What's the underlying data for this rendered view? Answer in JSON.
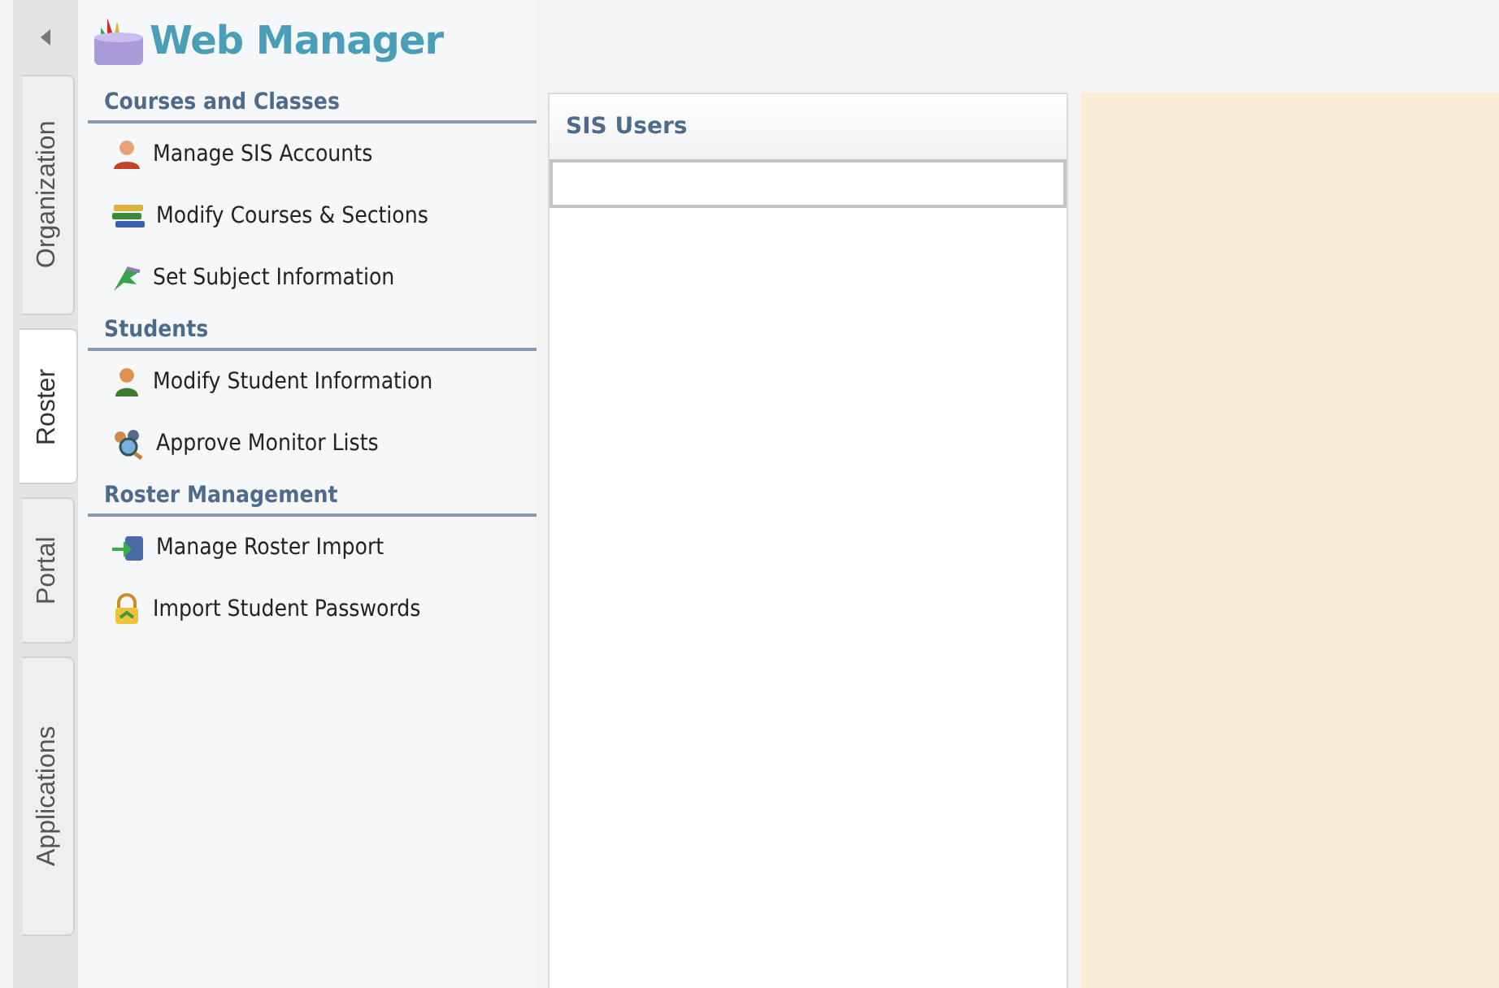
{
  "app": {
    "title": "Web Manager"
  },
  "side_tabs": [
    {
      "label": "Organization",
      "selected": false
    },
    {
      "label": "Roster",
      "selected": true
    },
    {
      "label": "Portal",
      "selected": false
    },
    {
      "label": "Applications",
      "selected": false
    }
  ],
  "sections": [
    {
      "title": "Courses and Classes",
      "items": [
        {
          "label": "Manage SIS Accounts"
        },
        {
          "label": "Modify Courses & Sections"
        },
        {
          "label": "Set Subject Information"
        }
      ]
    },
    {
      "title": "Students",
      "items": [
        {
          "label": "Modify Student Information"
        },
        {
          "label": "Approve Monitor Lists"
        }
      ]
    },
    {
      "title": "Roster Management",
      "items": [
        {
          "label": "Manage Roster Import"
        },
        {
          "label": "Import Student Passwords"
        }
      ]
    }
  ],
  "users_panel": {
    "title": "SIS Users"
  }
}
